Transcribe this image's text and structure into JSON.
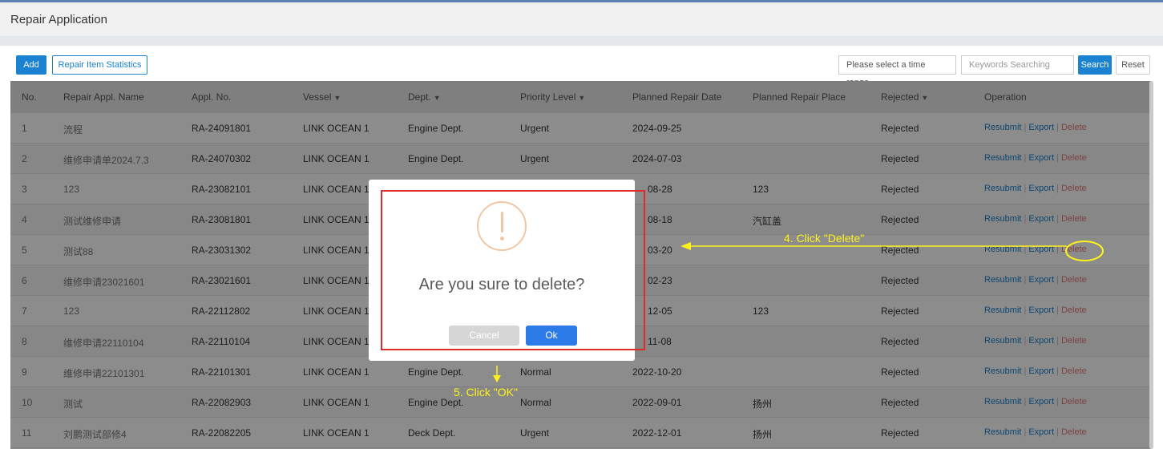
{
  "header": {
    "title": "Repair Application"
  },
  "toolbar": {
    "add_label": "Add",
    "stats_label": "Repair Item Statistics",
    "time_range_placeholder": "Please select a time range.",
    "keywords_placeholder": "Keywords Searching",
    "search_label": "Search",
    "reset_label": "Reset"
  },
  "table": {
    "columns": [
      "No.",
      "Repair Appl. Name",
      "Appl. No.",
      "Vessel",
      "Dept.",
      "Priority Level",
      "Planned Repair Date",
      "Planned Repair Place",
      "Rejected",
      "Operation"
    ],
    "rows": [
      {
        "no": "1",
        "name": "流程",
        "appl_no": "RA-24091801",
        "vessel": "LINK OCEAN 1",
        "dept": "Engine Dept.",
        "priority": "Urgent",
        "date": "2024-09-25",
        "place": "",
        "status": "Rejected"
      },
      {
        "no": "2",
        "name": "维修申请单2024.7.3",
        "appl_no": "RA-24070302",
        "vessel": "LINK OCEAN 1",
        "dept": "Engine Dept.",
        "priority": "Urgent",
        "date": "2024-07-03",
        "place": "",
        "status": "Rejected"
      },
      {
        "no": "3",
        "name": "123",
        "appl_no": "RA-23082101",
        "vessel": "LINK OCEAN 1",
        "dept": "",
        "priority": "",
        "date": "08-28",
        "place": "123",
        "status": "Rejected"
      },
      {
        "no": "4",
        "name": "测试维修申请",
        "appl_no": "RA-23081801",
        "vessel": "LINK OCEAN 1",
        "dept": "",
        "priority": "",
        "date": "08-18",
        "place": "汽缸盖",
        "status": "Rejected"
      },
      {
        "no": "5",
        "name": "测试88",
        "appl_no": "RA-23031302",
        "vessel": "LINK OCEAN 1",
        "dept": "",
        "priority": "",
        "date": "03-20",
        "place": "",
        "status": "Rejected"
      },
      {
        "no": "6",
        "name": "维修申请23021601",
        "appl_no": "RA-23021601",
        "vessel": "LINK OCEAN 1",
        "dept": "",
        "priority": "",
        "date": "02-23",
        "place": "",
        "status": "Rejected"
      },
      {
        "no": "7",
        "name": "123",
        "appl_no": "RA-22112802",
        "vessel": "LINK OCEAN 1",
        "dept": "",
        "priority": "",
        "date": "12-05",
        "place": "123",
        "status": "Rejected"
      },
      {
        "no": "8",
        "name": "维修申请22110104",
        "appl_no": "RA-22110104",
        "vessel": "LINK OCEAN 1",
        "dept": "",
        "priority": "",
        "date": "11-08",
        "place": "",
        "status": "Rejected"
      },
      {
        "no": "9",
        "name": "维修申请22101301",
        "appl_no": "RA-22101301",
        "vessel": "LINK OCEAN 1",
        "dept": "Engine Dept.",
        "priority": "Normal",
        "date": "2022-10-20",
        "place": "",
        "status": "Rejected"
      },
      {
        "no": "10",
        "name": "测试",
        "appl_no": "RA-22082903",
        "vessel": "LINK OCEAN 1",
        "dept": "Engine Dept.",
        "priority": "Normal",
        "date": "2022-09-01",
        "place": "扬州",
        "status": "Rejected"
      },
      {
        "no": "11",
        "name": "刘鹏测试部修4",
        "appl_no": "RA-22082205",
        "vessel": "LINK OCEAN 1",
        "dept": "Deck Dept.",
        "priority": "Urgent",
        "date": "2022-12-01",
        "place": "扬州",
        "status": "Rejected"
      }
    ],
    "operations": {
      "resubmit": "Resubmit",
      "export": "Export",
      "delete": "Delete"
    }
  },
  "dialog": {
    "icon": "warning-icon",
    "message": "Are you sure to delete?",
    "cancel_label": "Cancel",
    "ok_label": "Ok"
  },
  "annotations": {
    "step4": "4. Click \"Delete\"",
    "step5": "5. Click \"OK\""
  },
  "colors": {
    "primary": "#1a82d1",
    "delete": "#e2787a",
    "highlight_red": "#e02b2b",
    "annotation_yellow": "#fff21c",
    "ok_button": "#2d7be8"
  }
}
